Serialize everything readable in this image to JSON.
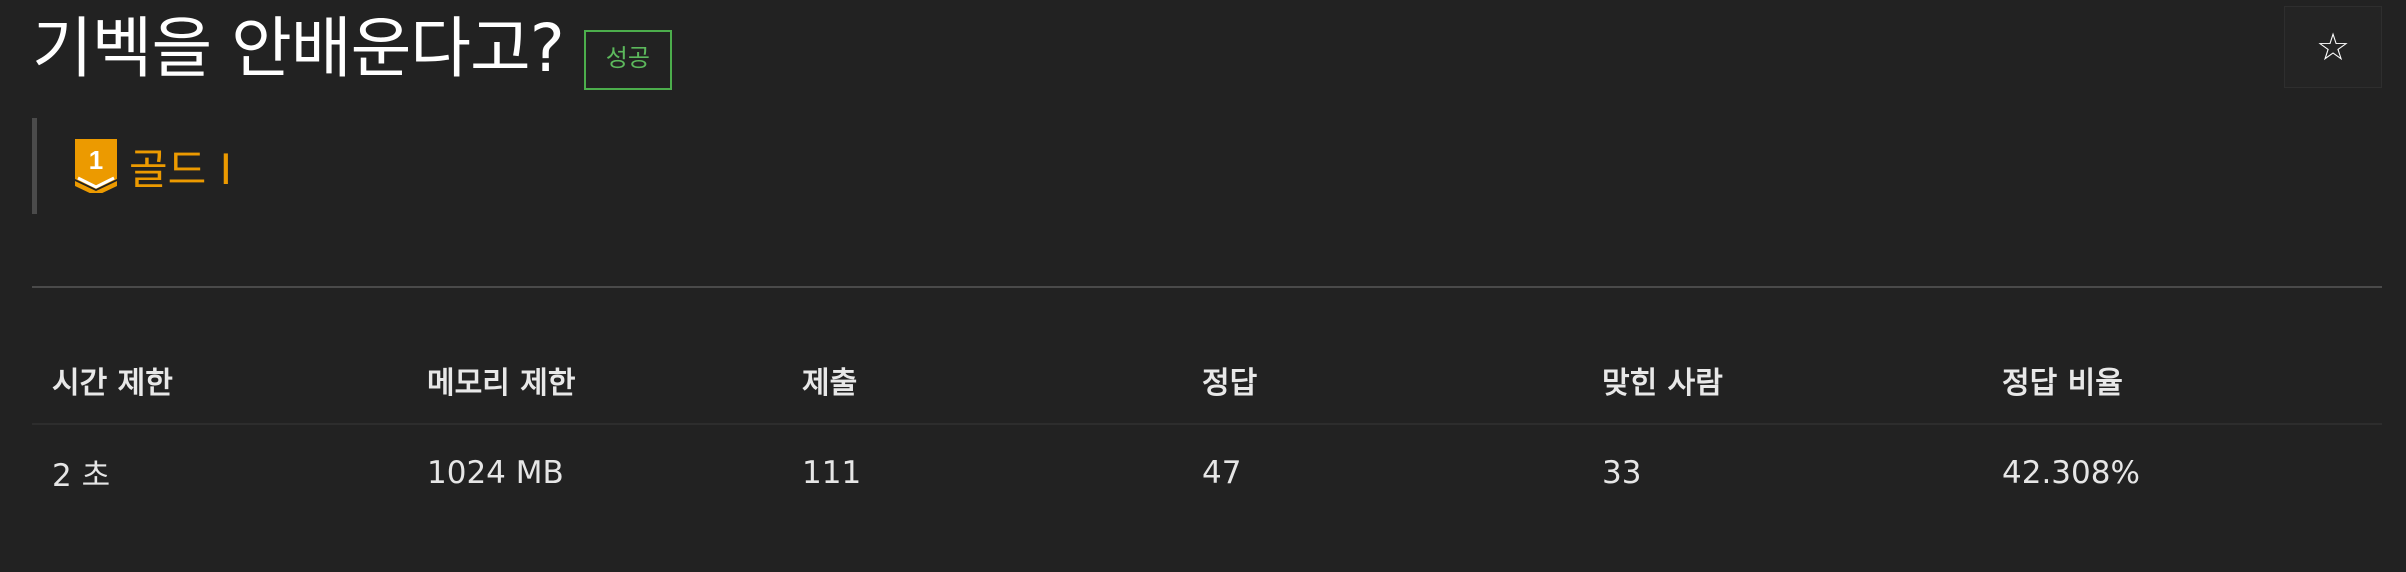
{
  "problem": {
    "title": "기벡을 안배운다고?",
    "status_badge": "성공"
  },
  "tier": {
    "icon": "gold-tier-1-icon",
    "label": "골드 I",
    "color": "#ec9a00"
  },
  "star_button": {
    "icon": "star-outline-icon",
    "glyph": "☆"
  },
  "info_table": {
    "headers": [
      "시간 제한",
      "메모리 제한",
      "제출",
      "정답",
      "맞힌 사람",
      "정답 비율"
    ],
    "row": [
      "2 초",
      "1024 MB",
      "111",
      "47",
      "33",
      "42.308%"
    ]
  },
  "colors": {
    "background": "#222222",
    "success": "#5cb85c",
    "gold": "#ec9a00"
  }
}
